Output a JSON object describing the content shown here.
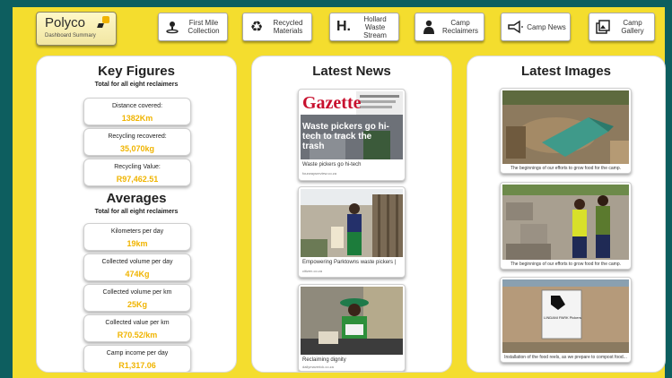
{
  "brand": {
    "name": "Polyco",
    "subtitle": "Dashboard Summary"
  },
  "nav": [
    {
      "label": "First Mile Collection",
      "icon": "person-pin-icon"
    },
    {
      "label": "Recycled Materials",
      "icon": "recycle-icon"
    },
    {
      "label": "Hollard Waste Stream",
      "icon": "hollard-logo-icon"
    },
    {
      "label": "Camp Reclaimers",
      "icon": "person-icon"
    },
    {
      "label": "Camp News",
      "icon": "megaphone-icon"
    },
    {
      "label": "Camp Gallery",
      "icon": "gallery-icon"
    }
  ],
  "key_figures": {
    "title": "Key Figures",
    "subtitle": "Total for all eight reclaimers",
    "stats": [
      {
        "label": "Distance covered:",
        "value": "1382Km"
      },
      {
        "label": "Recycling recovered:",
        "value": "35,070kg"
      },
      {
        "label": "Recycling Value:",
        "value": "R97,462.51"
      }
    ]
  },
  "averages": {
    "title": "Averages",
    "subtitle": "Total for all eight reclaimers",
    "stats": [
      {
        "label": "Kilometers per day",
        "value": "19km"
      },
      {
        "label": "Collected volume per day",
        "value": "474Kg"
      },
      {
        "label": "Collected volume per km",
        "value": "25Kg"
      },
      {
        "label": "Collected value per km",
        "value": "R70.52/km"
      },
      {
        "label": "Camp income per day",
        "value": "R1,317.06"
      }
    ]
  },
  "news": {
    "title": "Latest News",
    "items": [
      {
        "caption": "Waste pickers go hi-tech",
        "source": "fourwaysreview.co.za",
        "masthead": "Gazette",
        "headline": "Waste pickers go hi-tech to track the trash"
      },
      {
        "caption": "Empowering Parktowns waste pickers |",
        "source": "citizen.co.za"
      },
      {
        "caption": "Reclaiming dignity",
        "source": "dailymaverick.co.za"
      }
    ]
  },
  "images": {
    "title": "Latest Images",
    "items": [
      {
        "caption": "The beginnings of our efforts to grow food for the camp."
      },
      {
        "caption": "The beginnings of our efforts to grow food for the camp."
      },
      {
        "caption": "Installation of the food reels, as we prepare to compost food...",
        "sign": "LINDANI PARK Pickers"
      }
    ]
  }
}
